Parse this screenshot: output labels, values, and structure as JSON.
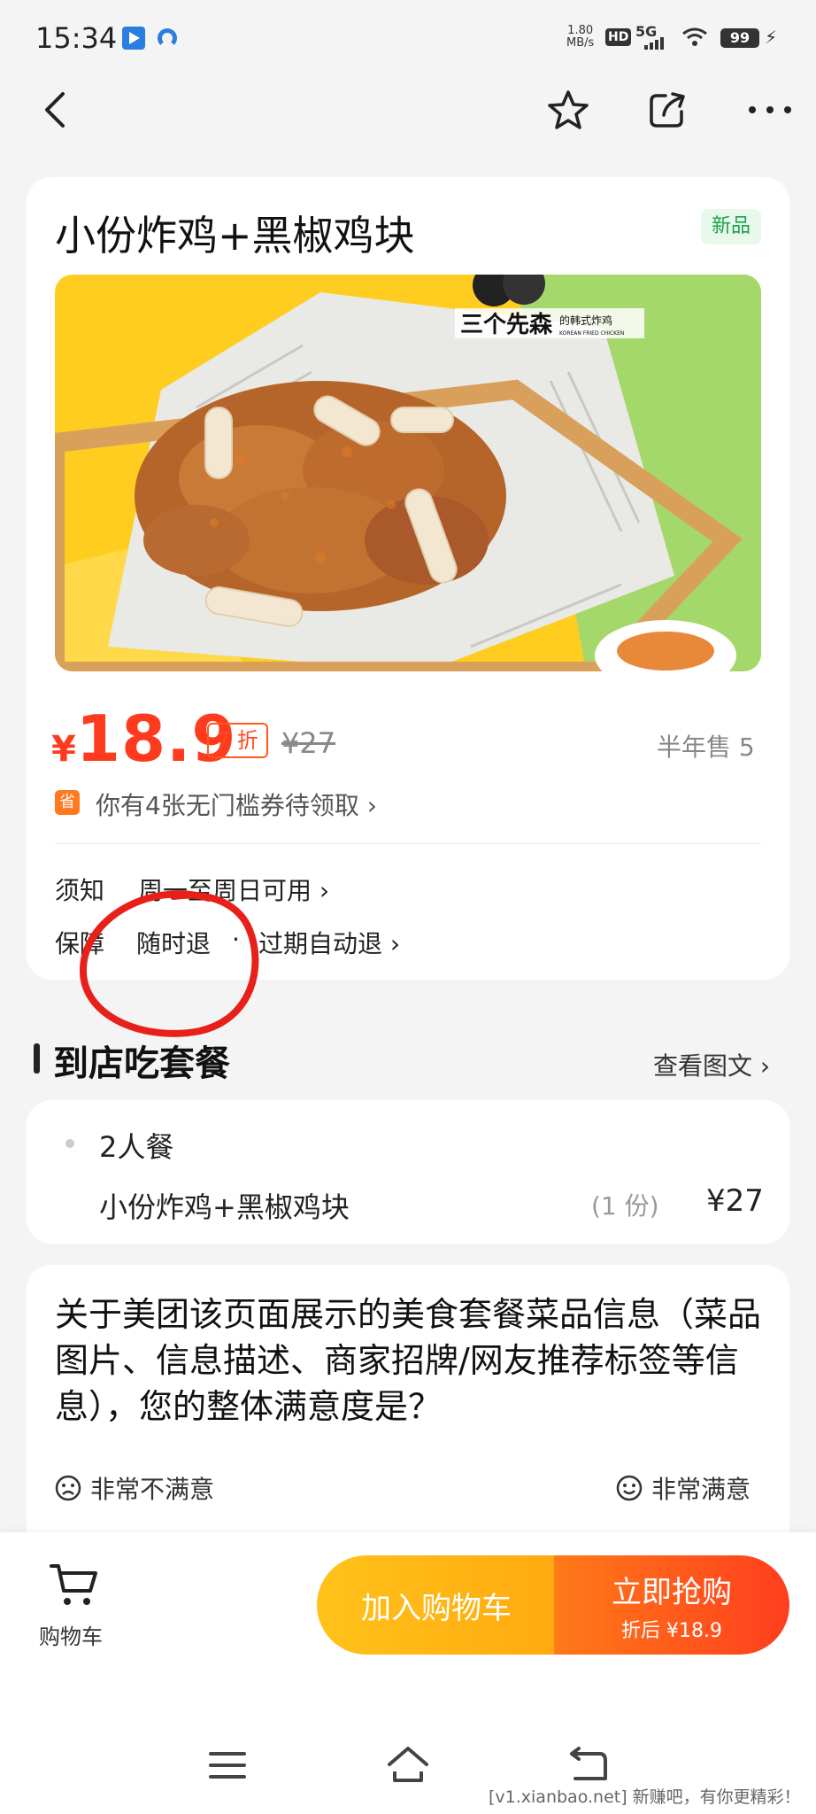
{
  "status_bar": {
    "time": "15:34",
    "speed_value": "1.80",
    "speed_unit": "MB/s",
    "hd": "HD",
    "network": "5G",
    "battery": "99"
  },
  "header": {
    "back_icon": "chevron-left-icon",
    "favorite_icon": "star-icon",
    "share_icon": "share-icon",
    "more_icon": "more-icon"
  },
  "product": {
    "title": "小份炸鸡+黑椒鸡块",
    "badge": "新品",
    "image_brand": "三个先森",
    "image_brand_sub": "的韩式炸鸡",
    "image_brand_en": "KOREAN FRIED CHICKEN",
    "price_symbol": "¥",
    "price": "18.9",
    "discount": "7 折",
    "original_price": "¥27",
    "sold": "半年售 5",
    "coupon_icon_text": "省",
    "coupon_text": "你有4张无门槛券待领取 ›",
    "notice_label": "须知",
    "notice_value": "周一至周日可用 ›",
    "guarantee_label": "保障",
    "guarantee_value_1": "随时退",
    "guarantee_sep": "·",
    "guarantee_value_2": "过期自动退 ›"
  },
  "set_meal": {
    "section_title": "到店吃套餐",
    "view_detail": "查看图文 ›",
    "group": "2人餐",
    "item_name": "小份炸鸡+黑椒鸡块",
    "item_qty": "(1 份)",
    "item_price": "¥27"
  },
  "survey": {
    "question": "关于美团该页面展示的美食套餐菜品信息（菜品图片、信息描述、商家招牌/网友推荐标签等信息），您的整体满意度是？",
    "left_label": "非常不满意",
    "right_label": "非常满意"
  },
  "bottom_bar": {
    "cart_label": "购物车",
    "add_to_cart": "加入购物车",
    "buy_now": "立即抢购",
    "buy_sub": "折后 ¥18.9"
  },
  "nav": {
    "menu_icon": "menu-icon",
    "home_icon": "home-icon",
    "back_icon": "back-icon"
  },
  "watermark": "[v1.xianbao.net] 新赚吧，有你更精彩！",
  "colors": {
    "price": "#ff3b1f",
    "add_button": "#ffb514",
    "buy_button": "#ff5a1c",
    "annotation": "#e8201a"
  }
}
